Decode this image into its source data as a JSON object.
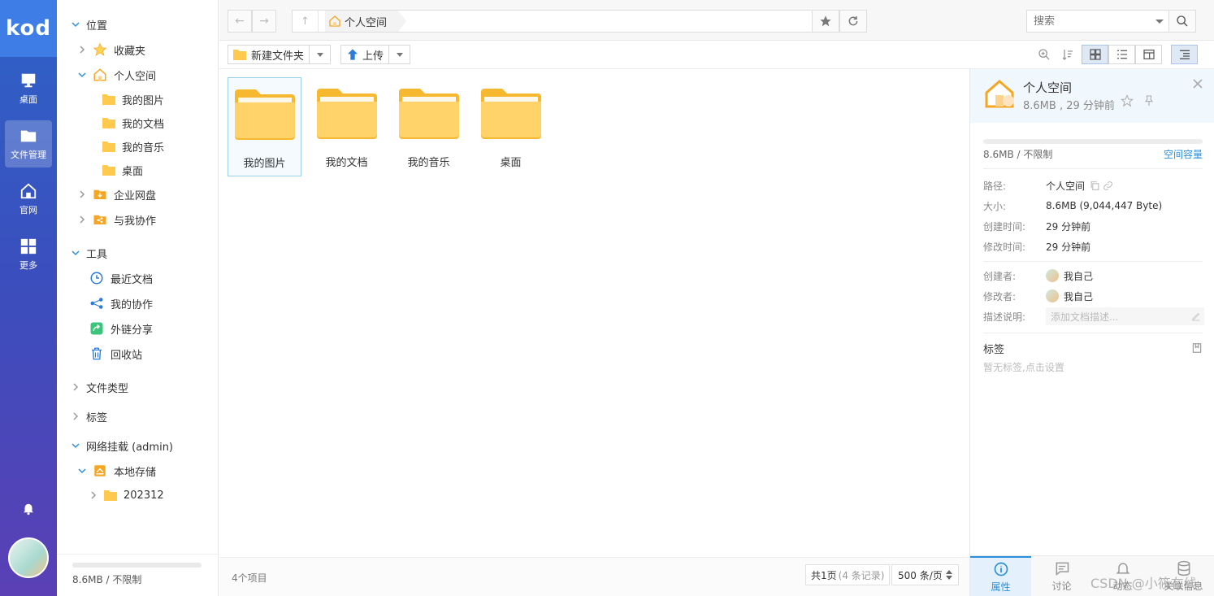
{
  "rail": {
    "logo": "kod",
    "items": [
      {
        "label": "桌面",
        "icon": "monitor-icon"
      },
      {
        "label": "文件管理",
        "icon": "folder-icon"
      },
      {
        "label": "官网",
        "icon": "home-icon"
      },
      {
        "label": "更多",
        "icon": "grid-icon"
      }
    ],
    "active_index": 1
  },
  "tree": {
    "location_label": "位置",
    "favorites": "收藏夹",
    "personal": "个人空间",
    "personal_children": [
      "我的图片",
      "我的文档",
      "我的音乐",
      "桌面"
    ],
    "enterprise": "企业网盘",
    "shared": "与我协作",
    "tools_label": "工具",
    "tools": [
      "最近文档",
      "我的协作",
      "外链分享",
      "回收站"
    ],
    "file_types": "文件类型",
    "tags": "标签",
    "network_mount": "网络挂载 (admin)",
    "local_storage": "本地存储",
    "local_child": "202312",
    "quota": "8.6MB / 不限制"
  },
  "header": {
    "back_glyph": "←",
    "forward_glyph": "→",
    "up_glyph": "↑",
    "breadcrumb": "个人空间",
    "search_placeholder": "搜索"
  },
  "toolbar": {
    "new_folder": "新建文件夹",
    "upload": "上传"
  },
  "files": [
    {
      "name": "我的图片",
      "selected": true
    },
    {
      "name": "我的文档",
      "selected": false
    },
    {
      "name": "我的音乐",
      "selected": false
    },
    {
      "name": "桌面",
      "selected": false
    }
  ],
  "status": {
    "count": "4个项目",
    "page": "共1页",
    "records": "(4 条记录)",
    "per_page": "500 条/页"
  },
  "props": {
    "title": "个人空间",
    "subtitle": "8.6MB , 29 分钟前",
    "quota": "8.6MB / 不限制",
    "quota_link": "空间容量",
    "rows": [
      {
        "k": "路径:",
        "v": "个人空间"
      },
      {
        "k": "大小:",
        "v": "8.6MB (9,044,447 Byte)"
      },
      {
        "k": "创建时间:",
        "v": "29 分钟前"
      },
      {
        "k": "修改时间:",
        "v": "29 分钟前"
      }
    ],
    "creator_label": "创建者:",
    "creator": "我自己",
    "modifier_label": "修改者:",
    "modifier": "我自己",
    "desc_label": "描述说明:",
    "desc_placeholder": "添加文档描述...",
    "tags_title": "标签",
    "tags_empty": "暂无标签,点击设置"
  },
  "ptabs": [
    "属性",
    "讨论",
    "动态",
    "关联信息"
  ],
  "watermark": "CSDN @小筱在线",
  "colors": {
    "rail_top": "#2e63c8",
    "rail_bottom": "#5a3fb5",
    "accent": "#2b90d9",
    "folder": "#ffc94d"
  }
}
